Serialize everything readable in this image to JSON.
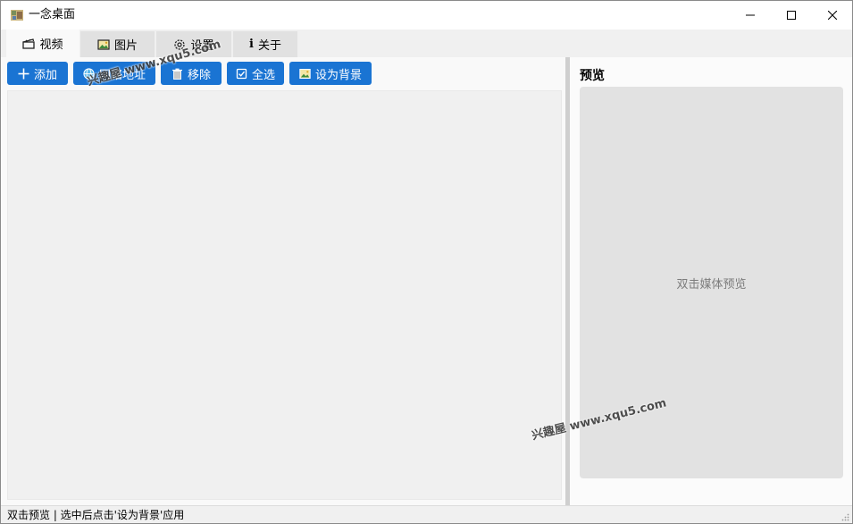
{
  "window": {
    "title": "一念桌面",
    "controls": [
      "minimize",
      "maximize",
      "close"
    ]
  },
  "tabs": [
    {
      "label": "视频",
      "icon": "film-icon",
      "active": true
    },
    {
      "label": "图片",
      "icon": "image-icon",
      "active": false
    },
    {
      "label": "设置",
      "icon": "gear-icon",
      "active": false
    },
    {
      "label": "关于",
      "icon": "info-icon",
      "active": false
    }
  ],
  "toolbar": {
    "add_label": "添加",
    "url_label": "网络地址",
    "remove_label": "移除",
    "select_all_label": "全选",
    "set_bg_label": "设为背景"
  },
  "preview": {
    "title": "预览",
    "hint": "双击媒体预览"
  },
  "status": {
    "text": "双击预览 | 选中后点击'设为背景'应用"
  },
  "watermark": {
    "text": "兴趣屋 www.xqu5.com"
  },
  "colors": {
    "accent": "#1a74d3",
    "preview_bg": "#e2e2e2",
    "list_bg": "#f0f0f0"
  }
}
